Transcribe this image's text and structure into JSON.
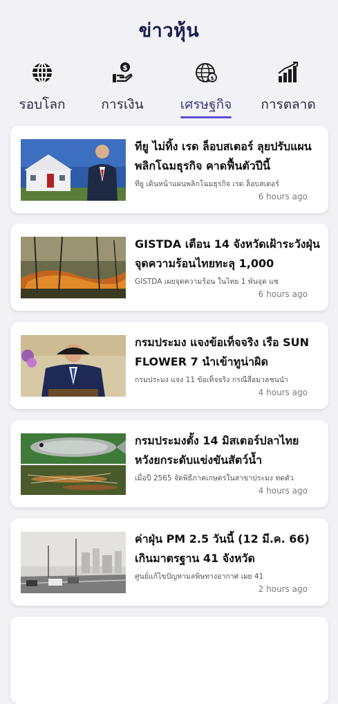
{
  "header": {
    "title": "ข่าวหุ้น"
  },
  "tabs": [
    {
      "label": "รอบโลก",
      "icon": "globe-icon"
    },
    {
      "label": "การเงิน",
      "icon": "money-hand-icon"
    },
    {
      "label": "เศรษฐกิจ",
      "icon": "economy-globe-icon",
      "active": true
    },
    {
      "label": "การตลาด",
      "icon": "bar-chart-icon"
    }
  ],
  "accent_color": "#5b4fd6",
  "articles": [
    {
      "title": "ทียู ไม่ทิ้ง เรด ล็อบสเตอร์ ลุยปรับแผนพลิกโฉมธุรกิจ คาดฟื้นตัวปีนี้",
      "summary": "ทียู เดินหน้าแผนพลิกโฉมธุรกิจ เรด ล็อบสเตอร์",
      "time": "6 hours ago"
    },
    {
      "title": "GISTDA เตือน 14 จังหวัดเฝ้าระวังฝุ่น จุดความร้อนไทยทะลุ 1,000",
      "summary": "GISTDA เผยจุดความร้อน ในไทย 1 พันจุด แซ",
      "time": "6 hours ago"
    },
    {
      "title": "กรมประมง แจงข้อเท็จจริง เรือ SUN FLOWER 7 นำเข้าทูน่าผิด",
      "summary": "กรมประมง แจง 11 ข้อเท็จจริง กรณีสื่อมวลชนนำ",
      "time": "4 hours ago"
    },
    {
      "title": "กรมประมงตั้ง 14 มิสเตอร์ปลาไทย หวังยกระดับแข่งขันสัตว์น้ำ",
      "summary": "เมื่อปี 2565 จัดพิธีภาคเกษตรในสาขาประมง ทดตัว",
      "time": "4 hours ago"
    },
    {
      "title": "ค่าฝุ่น PM 2.5 วันนี้ (12 มี.ค. 66) เกินมาตรฐาน 41 จังหวัด",
      "summary": "ศูนย์แก้ไขปัญหามลพิษทางอากาศ เผย 41",
      "time": "2 hours ago"
    }
  ]
}
